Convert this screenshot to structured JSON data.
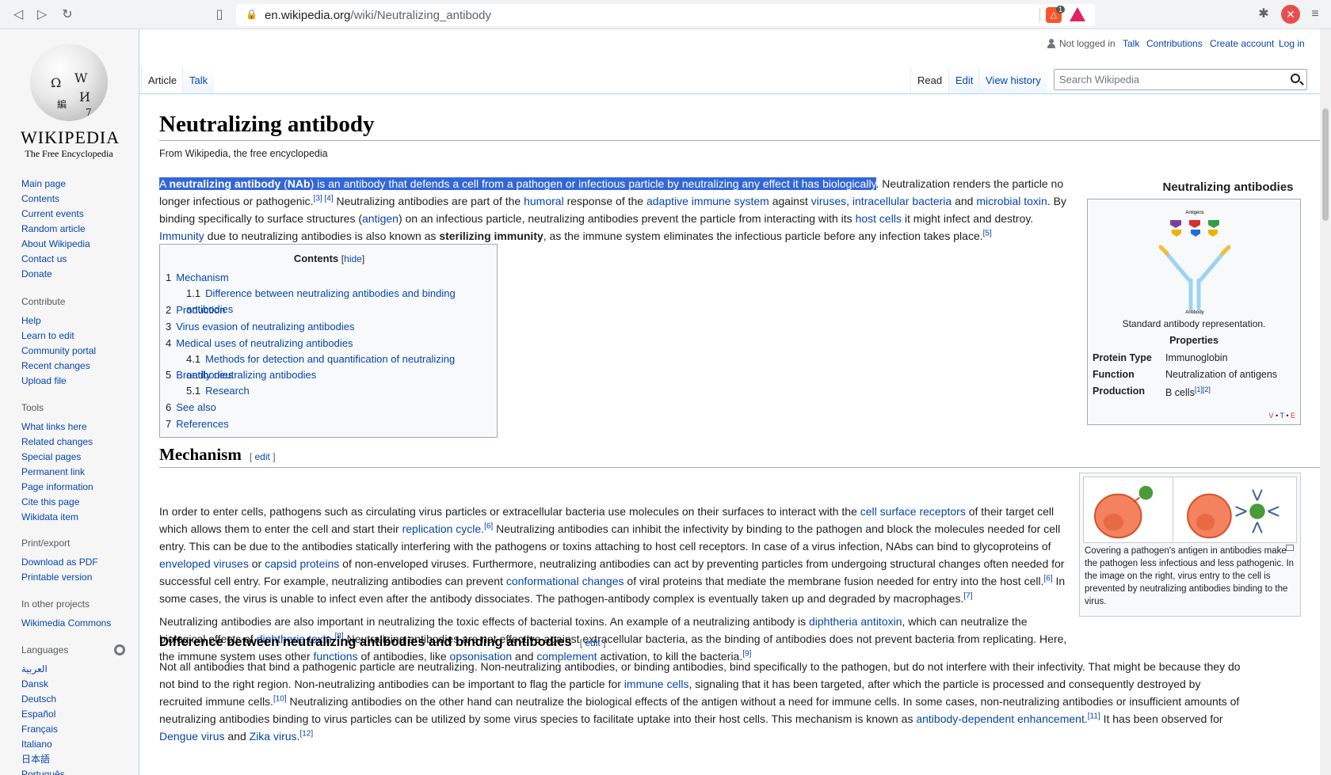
{
  "browser": {
    "url_host": "en.wikipedia.org",
    "url_path": "/wiki/Neutralizing_antibody",
    "brave_badge": "1"
  },
  "logo": {
    "wordmark": "WIKIPEDIA",
    "tagline": "The Free Encyclopedia"
  },
  "sidebar": {
    "nav": [
      "Main page",
      "Contents",
      "Current events",
      "Random article",
      "About Wikipedia",
      "Contact us",
      "Donate"
    ],
    "contribute_heading": "Contribute",
    "contribute": [
      "Help",
      "Learn to edit",
      "Community portal",
      "Recent changes",
      "Upload file"
    ],
    "tools_heading": "Tools",
    "tools": [
      "What links here",
      "Related changes",
      "Special pages",
      "Permanent link",
      "Page information",
      "Cite this page",
      "Wikidata item"
    ],
    "print_heading": "Print/export",
    "print": [
      "Download as PDF",
      "Printable version"
    ],
    "projects_heading": "In other projects",
    "projects": [
      "Wikimedia Commons"
    ],
    "languages_heading": "Languages",
    "languages": [
      "العربية",
      "Dansk",
      "Deutsch",
      "Español",
      "Français",
      "Italiano",
      "日本語",
      "Português"
    ]
  },
  "user": {
    "not_logged": "Not logged in",
    "talk": "Talk",
    "contributions": "Contributions",
    "create": "Create account",
    "login": "Log in"
  },
  "tabs": {
    "article": "Article",
    "talk": "Talk",
    "read": "Read",
    "edit": "Edit",
    "history": "View history"
  },
  "search": {
    "placeholder": "Search Wikipedia"
  },
  "page": {
    "title": "Neutralizing antibody",
    "from": "From Wikipedia, the free encyclopedia"
  },
  "intro": {
    "hl_a": "A ",
    "hl_bold": "neutralizing antibody",
    "hl_b": " (",
    "hl_nab": "NAb",
    "hl_c": ") is an ",
    "hl_antibody": "antibody",
    "hl_d": " that defends a cell from a ",
    "hl_pathogen": "pathogen",
    "hl_e": " or infectious particle by neutralizing any effect it has biologically",
    "t1": ". Neutralization renders the particle no longer infectious or pathogenic.",
    "ref3": "[3]",
    "ref4": "[4]",
    "t2": " Neutralizing antibodies are part of the ",
    "humoral": "humoral",
    "t3": " response of the ",
    "adaptive": "adaptive immune system",
    "t4": " against ",
    "viruses": "viruses",
    "t5": ", ",
    "intracellular": "intracellular bacteria",
    "t6": " and ",
    "microbial": "microbial toxin",
    "t7": ". By binding specifically to surface structures (",
    "antigen": "antigen",
    "t8": ") on an infectious particle, neutralizing antibodies prevent the particle from interacting with its ",
    "host_cells": "host cells",
    "t9": " it might infect and destroy.",
    "immunity": "Immunity",
    "t10": " due to neutralizing antibodies is also known as ",
    "sterilizing": "sterilizing immunity",
    "t11": ", as the immune system eliminates the infectious particle before any infection takes place.",
    "ref5": "[5]"
  },
  "infobox": {
    "title": "Neutralizing antibodies",
    "caption": "Standard antibody representation.",
    "properties": "Properties",
    "img_antigens": "Antigens",
    "img_antibody": "Antibody",
    "rows": [
      {
        "k": "Protein Type",
        "v": "Immunoglobin"
      },
      {
        "k": "Function",
        "v": "Neutralization of antigens"
      },
      {
        "k": "Production",
        "v": "B cells"
      }
    ],
    "ref1": "[1]",
    "ref2": "[2]",
    "v": "V",
    "t": "T",
    "e": "E"
  },
  "toc": {
    "title": "Contents",
    "hide": "hide",
    "items": [
      {
        "num": "1",
        "label": "Mechanism"
      },
      {
        "num": "1.1",
        "label": "Difference between neutralizing antibodies and binding antibodies"
      },
      {
        "num": "2",
        "label": "Production"
      },
      {
        "num": "3",
        "label": "Virus evasion of neutralizing antibodies"
      },
      {
        "num": "4",
        "label": "Medical uses of neutralizing antibodies"
      },
      {
        "num": "4.1",
        "label": "Methods for detection and quantification of neutralizing antibodies"
      },
      {
        "num": "5",
        "label": "Broadly neutralizing antibodies"
      },
      {
        "num": "5.1",
        "label": "Research"
      },
      {
        "num": "6",
        "label": "See also"
      },
      {
        "num": "7",
        "label": "References"
      }
    ]
  },
  "mechanism": {
    "heading": "Mechanism",
    "edit": "edit",
    "p1a": "In order to enter cells, pathogens such as circulating virus particles or extracellular bacteria use molecules on their surfaces to interact with the ",
    "csr": "cell surface receptors",
    "p1b": " of their target cell which allows them to enter the cell and start their ",
    "rep": "replication cycle",
    "p1c": ".",
    "ref6": "[6]",
    "p1d": " Neutralizing antibodies can inhibit the infectivity by binding to the pathogen and block the molecules needed for cell entry. This can be due to the antibodies statically interfering with the pathogens or toxins attaching to host cell receptors. In case of a virus infection, NAbs can bind to glycoproteins of ",
    "env": "enveloped viruses",
    "p1e": " or ",
    "cap": "capsid proteins",
    "p1f": " of non-enveloped viruses. Furthermore, neutralizing antibodies can act by preventing particles from undergoing structural changes often needed for successful cell entry. For example, neutralizing antibodies can prevent ",
    "conf": "conformational changes",
    "p1g": " of viral proteins that mediate the membrane fusion needed for entry into the host cell.",
    "ref6b": "[6]",
    "p1h": " In some cases, the virus is unable to infect even after the antibody dissociates. The pathogen-antibody complex is eventually taken up and degraded by macrophages.",
    "ref7": "[7]",
    "p2a": "Neutralizing antibodies are also important in neutralizing the toxic effects of bacterial toxins. An example of a neutralizing antibody is ",
    "dip": "diphtheria antitoxin",
    "p2b": ", which can neutralize the biological effects of ",
    "diptox": "diphtheria toxin",
    "p2c": ".",
    "ref8": "[8]",
    "p2d": " Neutralizing antibodies are not effective against extracellular bacteria, as the binding of antibodies does not prevent bacteria from replicating. Here, the immune system uses other ",
    "func": "functions",
    "p2e": " of antibodies, like ",
    "ops": "opsonisation",
    "p2f": " and ",
    "comp": "complement",
    "p2g": " activation, to kill the bacteria.",
    "ref9": "[9]",
    "thumb_caption": "Covering a pathogen's antigen in antibodies make the pathogen less infectious and less pathogenic. In the image on the right, virus entry to the cell is prevented by neutralizing antibodies binding to the virus."
  },
  "difference": {
    "heading": "Difference between neutralizing antibodies and binding antibodies",
    "edit": "edit",
    "p1a": "Not all antibodies that bind a pathogenic particle are neutralizing. Non-neutralizing antibodies, or binding antibodies, bind specifically to the pathogen, but do not interfere with their infectivity. That might be because they do not bind to the right region. Non-neutralizing antibodies can be important to flag the particle for ",
    "immune": "immune cells",
    "p1b": ", signaling that it has been targeted, after which the particle is processed and consequently destroyed by recruited immune cells.",
    "ref10": "[10]",
    "p1c": " Neutralizing antibodies on the other hand can neutralize the biological effects of the antigen without a need for immune cells. In some cases, non-neutralizing antibodies or insufficient amounts of neutralizing antibodies binding to virus particles can be utilized by some virus species to facilitate uptake into their host cells. This mechanism is known as ",
    "ade": "antibody-dependent enhancement",
    "p1d": ".",
    "ref11": "[11]",
    "p1e": " It has been observed for ",
    "dengue": "Dengue virus",
    "p1f": " and ",
    "zika": "Zika virus",
    "p1g": ".",
    "ref12": "[12]"
  }
}
